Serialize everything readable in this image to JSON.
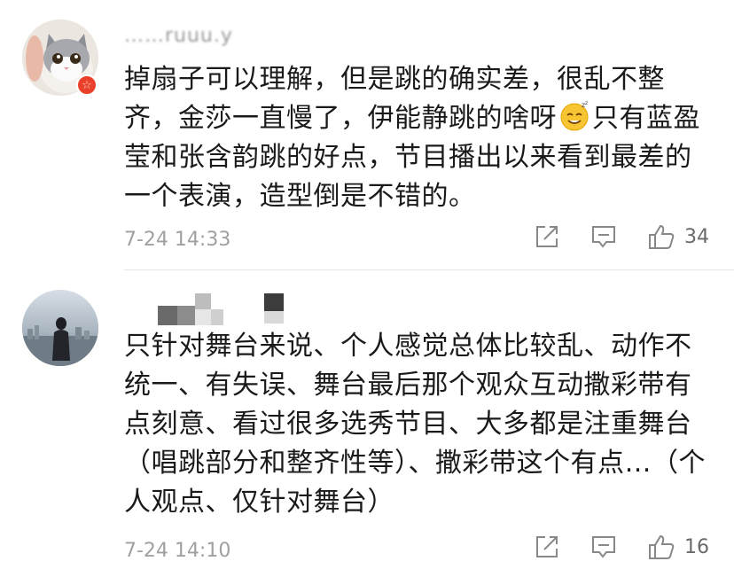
{
  "comments": [
    {
      "username": "……ruuu.y",
      "text": "掉扇子可以理解，但是跳的确实差，很乱不整齐，金莎一直慢了，伊能静跳的啥呀",
      "text_after_emoji": "只有蓝盈莹和张含韵跳的好点，节目播出以来看到最差的一个表演，造型倒是不错的。",
      "emoji": "sleepy-smile-emoji",
      "timestamp": "7-24 14:33",
      "likes": "34",
      "badge": "☆"
    },
    {
      "username": "",
      "text": "只针对舞台来说、个人感觉总体比较乱、动作不统一、有失误、舞台最后那个观众互动撒彩带有点刻意、看过很多选秀节目、大多都是注重舞台（唱跳部分和整齐性等）、撒彩带这个有点…（个人观点、仅针对舞台）",
      "timestamp": "7-24 14:10",
      "likes": "16"
    }
  ],
  "icons": {
    "share": "share-icon",
    "comment": "comment-icon",
    "like": "like-icon"
  },
  "colors": {
    "text": "#1a1a1a",
    "meta": "#a0a0a0",
    "badge": "#e8402a"
  }
}
